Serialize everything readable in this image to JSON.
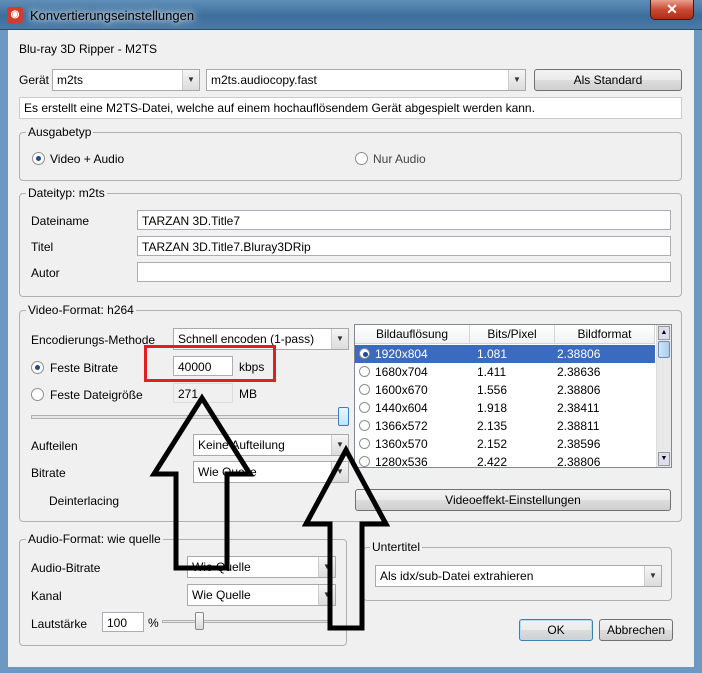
{
  "window": {
    "title": "Konvertierungseinstellungen",
    "close": "✕"
  },
  "header": {
    "profile": "Blu-ray 3D Ripper - M2TS"
  },
  "device": {
    "label": "Gerät",
    "format": "m2ts",
    "preset": "m2ts.audiocopy.fast",
    "default_button": "Als Standard"
  },
  "description": "Es erstellt eine M2TS-Datei, welche auf einem hochauflösendem Gerät abgespielt werden kann.",
  "output": {
    "title": "Ausgabetyp",
    "option_video_audio": "Video + Audio",
    "option_audio_only": "Nur Audio",
    "selected": "Video + Audio"
  },
  "file": {
    "title": "Dateityp: m2ts",
    "filename_label": "Dateiname",
    "filename": "TARZAN 3D.Title7",
    "title_label": "Titel",
    "title_value": "TARZAN 3D.Title7.Bluray3DRip",
    "author_label": "Autor",
    "author": ""
  },
  "video": {
    "title": "Video-Format: h264",
    "encoding_label": "Encodierungs-Methode",
    "encoding_value": "Schnell encoden (1-pass)",
    "fixed_bitrate_label": "Feste Bitrate",
    "bitrate_value": "40000",
    "bitrate_unit": "kbps",
    "fixed_size_label": "Feste Dateigröße",
    "size_value": "271",
    "size_unit": "MB",
    "split_label": "Aufteilen",
    "split_value": "Keine Aufteilung",
    "bitrate_label": "Bitrate",
    "bitrate_sel": "Wie Quelle",
    "deinterlace_label": "Deinterlacing",
    "effects_button": "Videoeffekt-Einstellungen",
    "slider_level": 1.0
  },
  "resolution_table": {
    "headers": [
      "Bildauflösung",
      "Bits/Pixel",
      "Bildformat"
    ],
    "rows": [
      [
        "1920x804",
        "1.081",
        "2.38806"
      ],
      [
        "1680x704",
        "1.411",
        "2.38636"
      ],
      [
        "1600x670",
        "1.556",
        "2.38806"
      ],
      [
        "1440x604",
        "1.918",
        "2.38411"
      ],
      [
        "1366x572",
        "2.135",
        "2.38811"
      ],
      [
        "1360x570",
        "2.152",
        "2.38596"
      ],
      [
        "1280x536",
        "2.422",
        "2.38806"
      ]
    ],
    "selected_index": 0
  },
  "audio": {
    "title": "Audio-Format: wie quelle",
    "bitrate_label": "Audio-Bitrate",
    "bitrate_value": "Wie Quelle",
    "channel_label": "Kanal",
    "channel_value": "Wie Quelle",
    "volume_label": "Lautstärke",
    "volume_value": "100",
    "volume_unit": "%"
  },
  "subtitle": {
    "title": "Untertitel",
    "value": "Als idx/sub-Datei extrahieren"
  },
  "buttons": {
    "ok": "OK",
    "cancel": "Abbrechen"
  },
  "colors": {
    "highlight_box": "#e02020",
    "selection": "#3a6bbf"
  }
}
